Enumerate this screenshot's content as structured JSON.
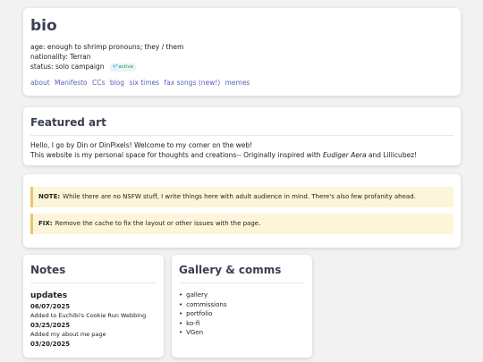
{
  "bio": {
    "title": "bio",
    "age": "age: enough to shrimp pronouns; they / them",
    "nationality": "nationality: Terran",
    "status_label": "status: solo campaign",
    "status_badge": "💎active",
    "nav": [
      "about",
      "Manifesto",
      "CCs",
      "blog",
      "six times",
      "fax songs (new!)",
      "memes"
    ]
  },
  "featured": {
    "title": "Featured art",
    "line1": "Hello, I go by Din or DinPixels! Welcome to my corner on the web!",
    "line2_prefix": "This website is my personal space for thoughts and creations-- Originally inspired with ",
    "line2_em": "Eudiger Aera",
    "line2_suffix": " and Lillicubez!"
  },
  "notices": [
    {
      "label": "NOTE:",
      "text": "While there are no NSFW stuff, I write things here with adult audience in mind. There's also few profanity ahead."
    },
    {
      "label": "FIX:",
      "text": "Remove the cache to fix the layout or other issues with the page."
    }
  ],
  "notes": {
    "title": "Notes",
    "subtitle": "updates",
    "entries": [
      {
        "date": "06/07/2025",
        "text": "Added to Euchibi's Cookie Run Webbing"
      },
      {
        "date": "03/25/2025",
        "text": "Added my about me page"
      },
      {
        "date": "03/20/2025",
        "text": ""
      }
    ]
  },
  "gallery": {
    "title": "Gallery & comms",
    "items": [
      "gallery",
      "commissions",
      "portfolio",
      "ko-fi",
      "VGen"
    ]
  }
}
